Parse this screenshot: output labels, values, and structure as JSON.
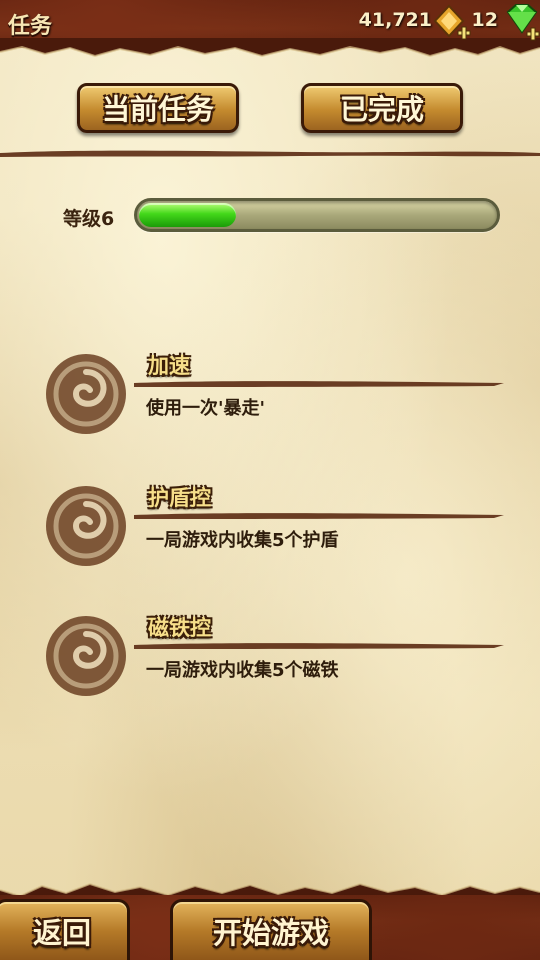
{
  "header": {
    "title": "任务",
    "coins": "41,721",
    "gems": "12",
    "coin_icon": "gold-diamond-plus-icon",
    "gem_icon": "green-gem-plus-icon"
  },
  "tabs": [
    {
      "label": "当前任务"
    },
    {
      "label": "已完成"
    }
  ],
  "level": {
    "label": "等级6",
    "progress": 0.28
  },
  "missions": [
    {
      "title": "加速",
      "description": "使用一次'暴走'",
      "icon": "swirl-emblem-icon"
    },
    {
      "title": "护盾控",
      "description": "一局游戏内收集5个护盾",
      "icon": "swirl-emblem-icon"
    },
    {
      "title": "磁铁控",
      "description": "一局游戏内收集5个磁铁",
      "icon": "swirl-emblem-icon"
    }
  ],
  "footer": {
    "back_label": "返回",
    "start_label": "开始游戏"
  },
  "colors": {
    "accent_gold": "#c48a2e",
    "progress_green": "#43d81a",
    "leather": "#6d2812",
    "parchment": "#efe2bb"
  }
}
